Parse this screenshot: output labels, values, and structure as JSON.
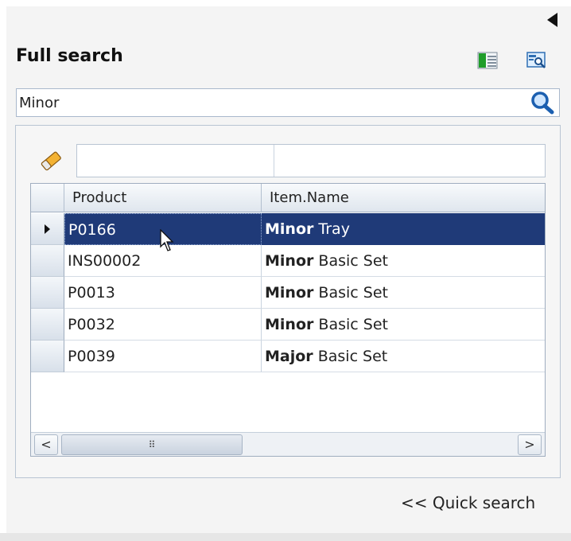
{
  "panel": {
    "title": "Full search",
    "collapse_icon": "triangle-left-icon",
    "toolbar_icons": [
      "grid-layout-icon",
      "search-preview-icon"
    ]
  },
  "search": {
    "value": "Minor",
    "button_icon": "magnifier-icon"
  },
  "filter": {
    "clear_icon": "eraser-icon",
    "cells": [
      "",
      ""
    ]
  },
  "grid": {
    "columns": [
      "Product",
      "Item.Name"
    ],
    "rows": [
      {
        "product": "P0166",
        "name_bold": "Minor",
        "name_rest": "Tray",
        "selected": true
      },
      {
        "product": "INS00002",
        "name_bold": "Minor",
        "name_rest": "Basic Set",
        "selected": false
      },
      {
        "product": "P0013",
        "name_bold": "Minor",
        "name_rest": "Basic Set",
        "selected": false
      },
      {
        "product": "P0032",
        "name_bold": "Minor",
        "name_rest": "Basic Set",
        "selected": false
      },
      {
        "product": "P0039",
        "name_bold": "Major",
        "name_rest": "Basic Set",
        "selected": false
      }
    ],
    "scroll_left": "<",
    "scroll_thumb": "⠿",
    "scroll_right": ">"
  },
  "footer": {
    "quick_search": "<< Quick search"
  },
  "colors": {
    "selected_row": "#1f3a78",
    "search_icon": "#1b5fb0"
  }
}
